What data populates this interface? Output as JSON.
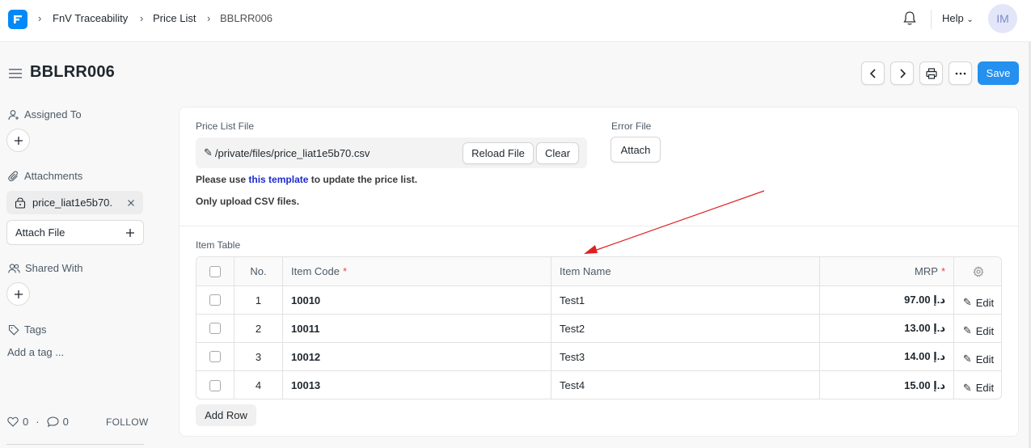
{
  "navbar": {
    "breadcrumbs": [
      "FnV Traceability",
      "Price List",
      "BBLRR006"
    ],
    "help_label": "Help",
    "avatar_initials": "IM"
  },
  "header": {
    "title": "BBLRR006",
    "save_label": "Save"
  },
  "sidebar": {
    "assigned_to_label": "Assigned To",
    "attachments_label": "Attachments",
    "attachment_name": "price_liat1e5b70.",
    "attach_file_label": "Attach File",
    "shared_with_label": "Shared With",
    "tags_label": "Tags",
    "add_tag_placeholder": "Add a tag ...",
    "likes_count": "0",
    "comments_count": "0",
    "follow_label": "FOLLOW"
  },
  "form": {
    "price_list_file_label": "Price List File",
    "file_path": "/private/files/price_liat1e5b70.csv",
    "reload_file_label": "Reload File",
    "clear_label": "Clear",
    "error_file_label": "Error File",
    "attach_label": "Attach",
    "help_prefix": "Please use ",
    "help_link": "this template",
    "help_suffix": " to update the price list.",
    "csv_note": "Only upload CSV files."
  },
  "table": {
    "label": "Item Table",
    "columns": {
      "no": "No.",
      "item_code": "Item Code",
      "item_name": "Item Name",
      "mrp": "MRP",
      "required_mark": "*"
    },
    "rows": [
      {
        "no": "1",
        "item_code": "10010",
        "item_name": "Test1",
        "mrp": "97.00 د.إ",
        "edit": "Edit"
      },
      {
        "no": "2",
        "item_code": "10011",
        "item_name": "Test2",
        "mrp": "13.00 د.إ",
        "edit": "Edit"
      },
      {
        "no": "3",
        "item_code": "10012",
        "item_name": "Test3",
        "mrp": "14.00 د.إ",
        "edit": "Edit"
      },
      {
        "no": "4",
        "item_code": "10013",
        "item_name": "Test4",
        "mrp": "15.00 د.إ",
        "edit": "Edit"
      }
    ],
    "add_row_label": "Add Row"
  },
  "colors": {
    "primary": "#2490ef",
    "logo": "#0289f7",
    "link": "#1b2bd4",
    "required": "#e24c4c",
    "annotation_arrow": "#e02020"
  }
}
